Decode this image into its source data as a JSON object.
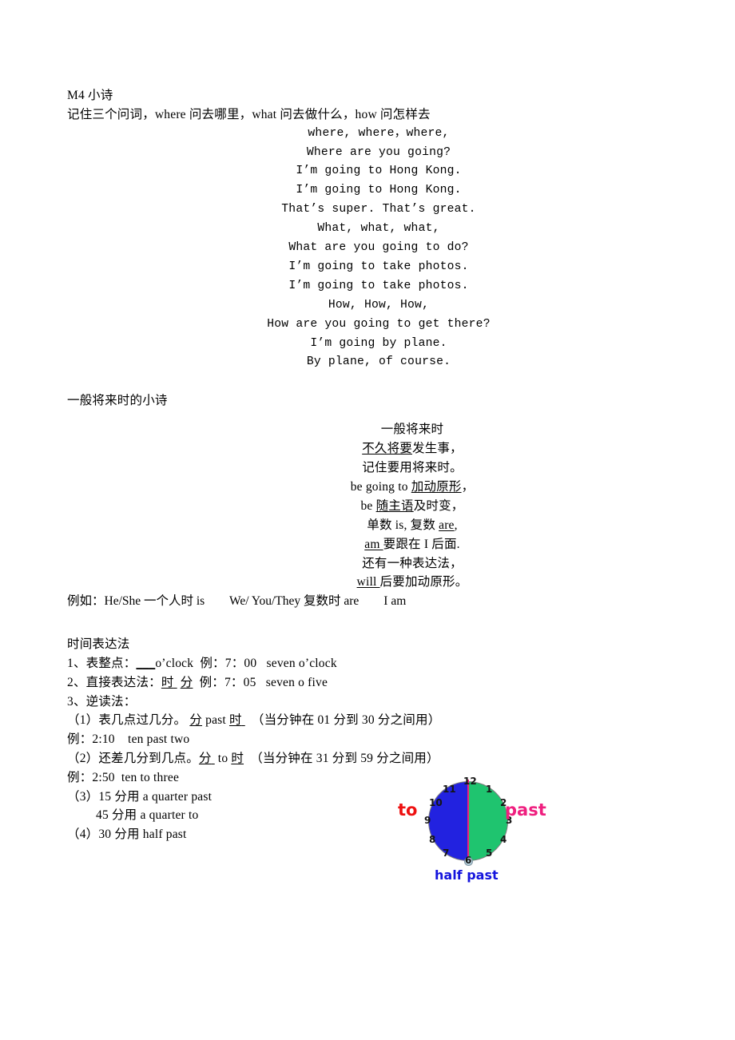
{
  "document": {
    "section1": {
      "title": "M4 小诗",
      "intro": "记住三个问词，where 问去哪里，what 问去做什么，how 问怎样去",
      "poem_lines": [
        "where, where，where,",
        "Where are you going?",
        "I’m going to Hong Kong.",
        "I’m going to Hong Kong.",
        "That’s super. That’s great.",
        "What, what, what,",
        "What are you going to do?",
        "I’m going to take photos.",
        "I’m going to take photos.",
        "How, How, How,",
        "How are you going to get there?",
        "I’m going by plane.",
        "By plane, of course."
      ]
    },
    "section2": {
      "title": "一般将来时的小诗",
      "poem": [
        {
          "plain_before": "一般将来时",
          "underline": "",
          "plain_after": ""
        },
        {
          "plain_before": "",
          "underline": "不久将要",
          "plain_after": "发生事，"
        },
        {
          "plain_before": "记住要用将来时。",
          "underline": "",
          "plain_after": ""
        },
        {
          "plain_before": "be going to ",
          "underline": "加动原形",
          "plain_after": "，"
        },
        {
          "plain_before": "be ",
          "underline": "随主语",
          "plain_after": "及时变，"
        },
        {
          "plain_before": "单数 is, 复数 ",
          "underline": "are",
          "plain_after": ","
        },
        {
          "plain_before": "",
          "underline": "am ",
          "plain_after": "要跟在 I 后面."
        },
        {
          "plain_before": "还有一种表达法，",
          "underline": "",
          "plain_after": ""
        },
        {
          "plain_before": "",
          "underline": "will ",
          "plain_after": "后要加动原形。"
        }
      ],
      "example_line": "例如：He/She 一个人时 is        We/ You/They 复数时 are        I am"
    },
    "section3": {
      "title": "时间表达法",
      "item1": {
        "label": "1、表整点：",
        "blank": "___",
        "formula": "o’clock",
        "example_label": "例：7：00",
        "example_value": "seven o’clock"
      },
      "item2": {
        "label": "2、直接表达法：",
        "u1": "时",
        "u2": "分",
        "example_label": "例：7：05",
        "example_value": "seven o five"
      },
      "item3": {
        "label": "3、逆读法：",
        "sub1": {
          "label": "（1）表几点过几分。",
          "u1": "分",
          "mid": " past ",
          "u2": "时",
          "note": "（当分钟在 01 分到 30 分之间用）"
        },
        "sub1_example": "例：2:10    ten past two",
        "sub2": {
          "label": "（2）还差几分到几点。",
          "u1": "分",
          "mid": " to ",
          "u2": "时",
          "note": "（当分钟在 31 分到 59 分之间用）"
        },
        "sub2_example": "例：2:50  ten to three",
        "sub3_a": "（3）15 分用 a quarter past",
        "sub3_b": "45 分用 a quarter to",
        "sub4": "（4）30 分用 half past"
      }
    },
    "clock": {
      "numbers": [
        "12",
        "1",
        "2",
        "3",
        "4",
        "5",
        "6",
        "7",
        "8",
        "9",
        "10",
        "11"
      ],
      "label_to": "to",
      "label_past": "past",
      "label_half_past": "half past",
      "colors": {
        "left_half": "#2222e0",
        "right_half": "#1fc46f",
        "divider": "#ef1f7f",
        "to": "#ee1111",
        "past": "#ef1f7f",
        "half_past": "#1414dd"
      }
    }
  }
}
